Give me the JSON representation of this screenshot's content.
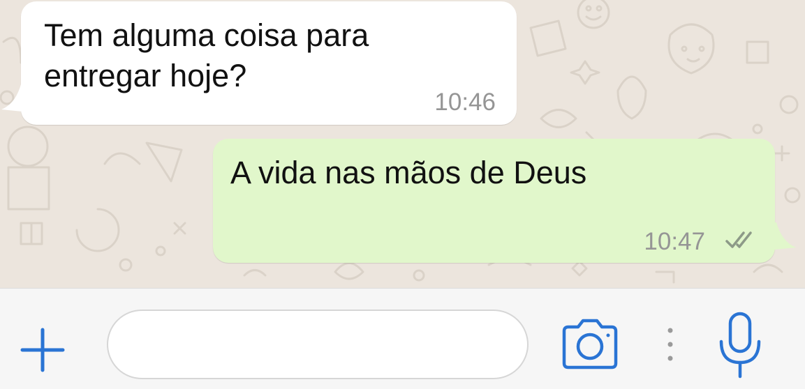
{
  "colors": {
    "chat_background": "#ece5dd",
    "incoming_bubble": "#ffffff",
    "outgoing_bubble": "#e1f7cb",
    "accent_blue": "#2a74d4",
    "timestamp_gray": "#959595",
    "read_ticks": "#8d9a88"
  },
  "messages": [
    {
      "direction": "incoming",
      "text": "Tem alguma coisa para\nentregar hoje?",
      "time": "10:46"
    },
    {
      "direction": "outgoing",
      "text": "A vida nas mãos de Deus",
      "time": "10:47",
      "status_icon": "double-check-icon"
    }
  ],
  "input_bar": {
    "left_icon": "plus-icon",
    "message_value": "",
    "message_placeholder": "",
    "icons": [
      "camera-icon",
      "vertical-dots-icon",
      "microphone-icon"
    ]
  }
}
